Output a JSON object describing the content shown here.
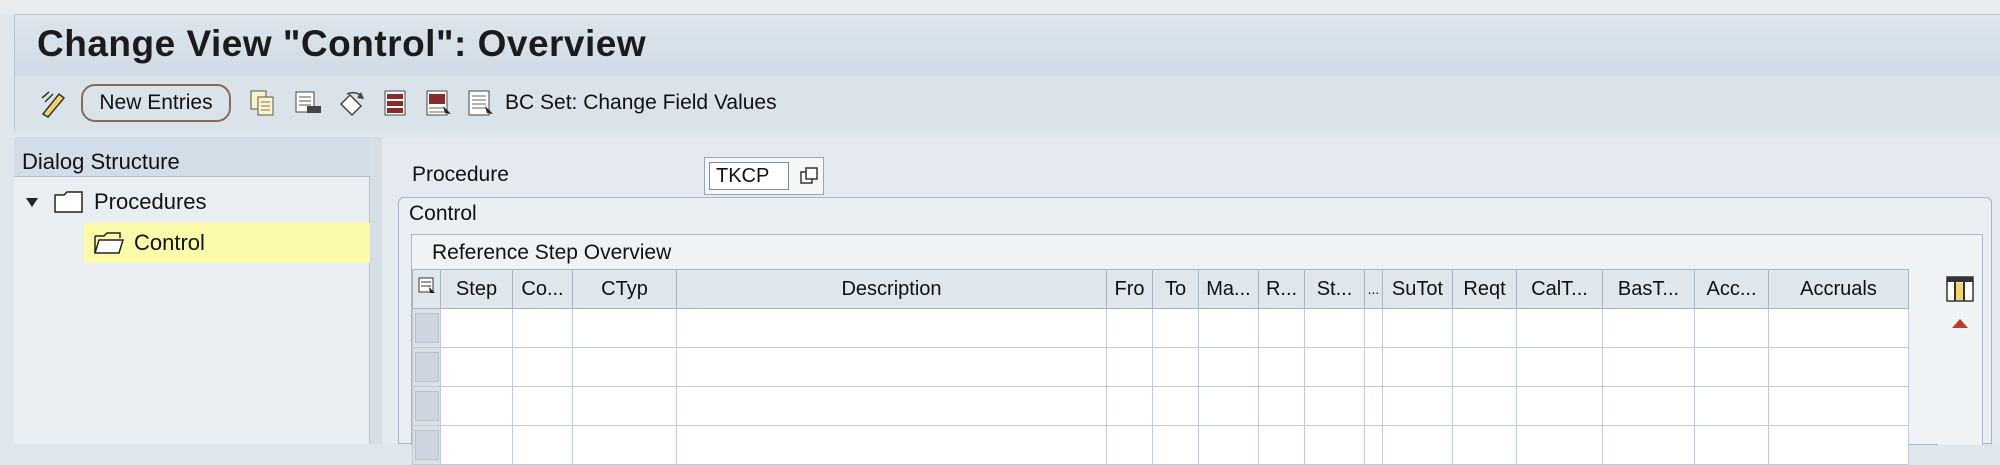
{
  "window": {
    "title": "Change View \"Control\": Overview"
  },
  "toolbar": {
    "new_entries_label": "New Entries",
    "bc_set_label": "BC Set: Change Field Values",
    "icons": [
      "display-change-icon",
      "copy-icon",
      "delete-icon",
      "undo-icon",
      "select-all-icon",
      "select-block-icon",
      "deselect-all-icon"
    ]
  },
  "dialog_structure": {
    "header": "Dialog Structure",
    "items": [
      {
        "label": "Procedures",
        "expanded": true,
        "level": 0
      },
      {
        "label": "Control",
        "selected": true,
        "level": 1
      }
    ]
  },
  "form": {
    "procedure_label": "Procedure",
    "procedure_value": "TKCP",
    "group_title": "Control",
    "subgroup_title": "Reference Step Overview"
  },
  "table": {
    "columns": [
      "Step",
      "Co...",
      "CTyp",
      "Description",
      "Fro",
      "To",
      "Ma...",
      "R...",
      "St...",
      "...",
      "SuTot",
      "Reqt",
      "CalT...",
      "BasT...",
      "Acc...",
      "Accruals"
    ],
    "rows": [
      [
        "",
        "",
        "",
        "",
        "",
        "",
        "",
        "",
        "",
        "",
        "",
        "",
        "",
        "",
        "",
        ""
      ],
      [
        "",
        "",
        "",
        "",
        "",
        "",
        "",
        "",
        "",
        "",
        "",
        "",
        "",
        "",
        "",
        ""
      ],
      [
        "",
        "",
        "",
        "",
        "",
        "",
        "",
        "",
        "",
        "",
        "",
        "",
        "",
        "",
        "",
        ""
      ],
      [
        "",
        "",
        "",
        "",
        "",
        "",
        "",
        "",
        "",
        "",
        "",
        "",
        "",
        "",
        "",
        ""
      ]
    ]
  },
  "colors": {
    "selected_tree_item": "#fbfaa8",
    "titlebar": "#d5dfe8"
  }
}
